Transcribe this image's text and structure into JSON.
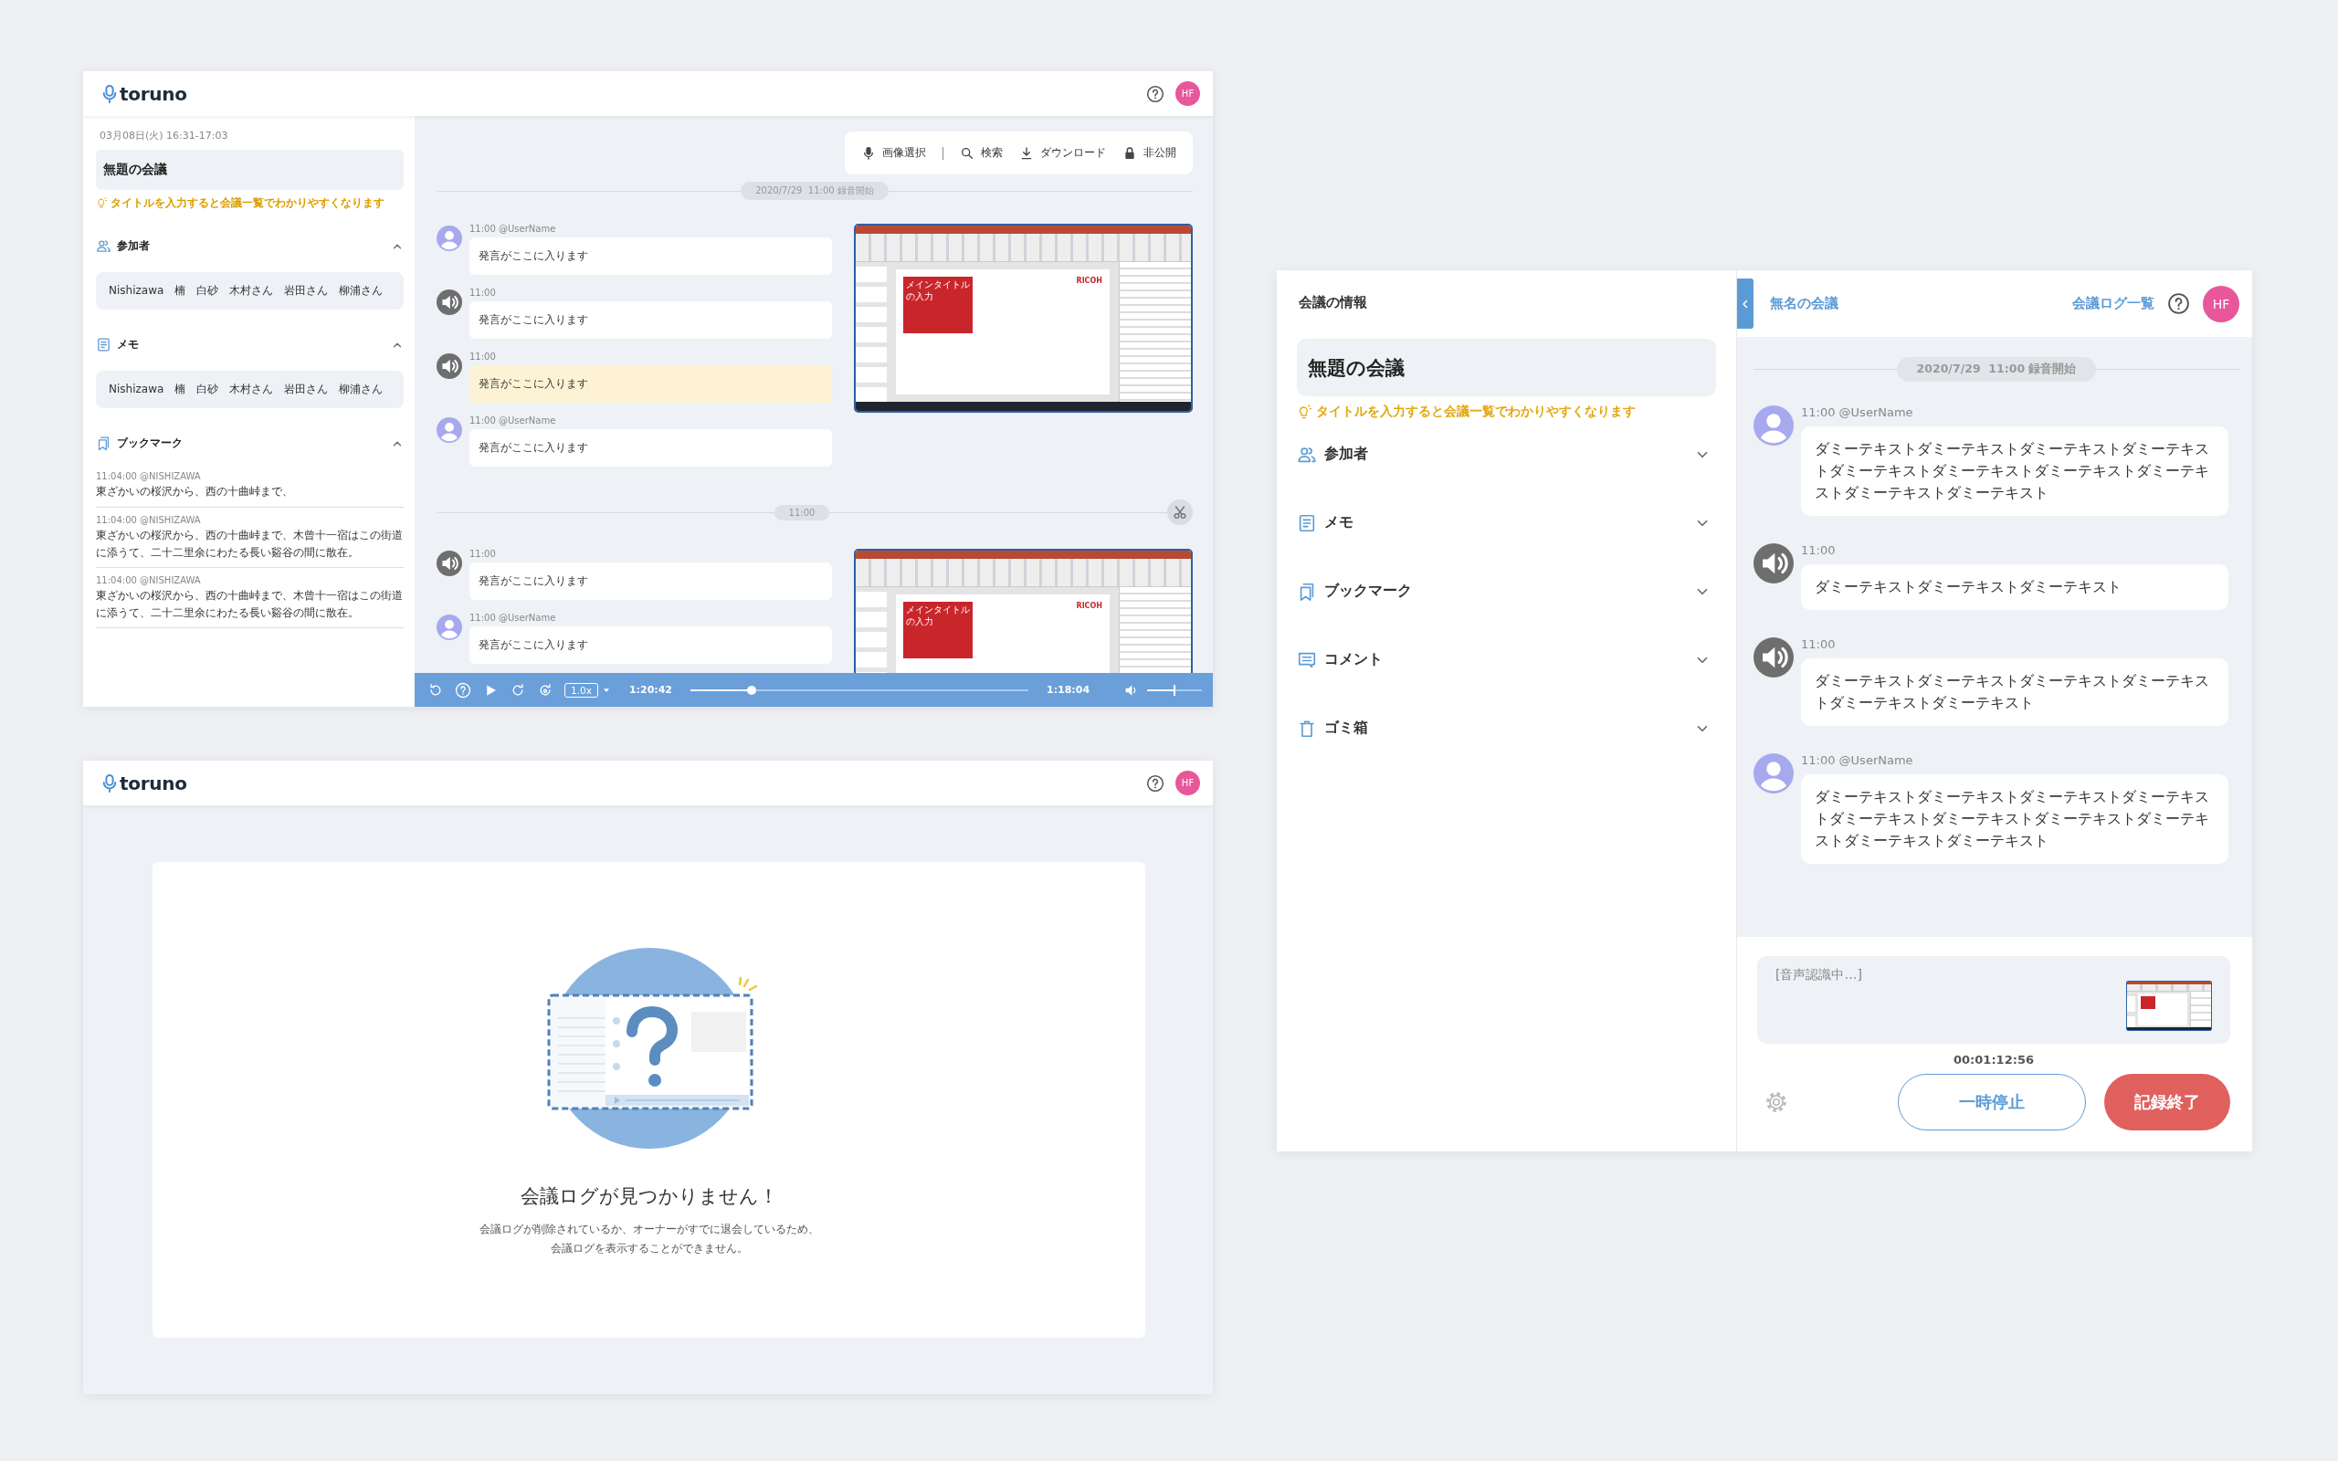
{
  "player_window": {
    "header": {
      "logo": "toruno",
      "avatar": "HF"
    },
    "sidebar": {
      "datetime": "03月08日(火) 16:31-17:03",
      "title": "無題の会議",
      "hint": "タイトルを入力すると会議一覧でわかりやすくなります",
      "sections": [
        {
          "kind": "participants",
          "label": "参加者",
          "expanded": true,
          "text": "Nishizawa　楠　白砂　木村さん　岩田さん　柳浦さん"
        },
        {
          "kind": "memo",
          "label": "メモ",
          "expanded": true,
          "text": "Nishizawa　楠　白砂　木村さん　岩田さん　柳浦さん"
        },
        {
          "kind": "bookmarks",
          "label": "ブックマーク",
          "expanded": true,
          "entries": [
            {
              "meta": "11:04:00 @NISHIZAWA",
              "text": "東ざかいの桜沢から、西の十曲峠まで、"
            },
            {
              "meta": "11:04:00 @NISHIZAWA",
              "text": "東ざかいの桜沢から、西の十曲峠まで、木曾十一宿はこの街道に添うて、二十二里余にわたる長い谿谷の間に散在。"
            },
            {
              "meta": "11:04:00 @NISHIZAWA",
              "text": "東ざかいの桜沢から、西の十曲峠まで、木曾十一宿はこの街道に添うて、二十二里余にわたる長い谿谷の間に散在。"
            }
          ]
        }
      ]
    },
    "toolbar": [
      {
        "kind": "mic",
        "label": "画像選択"
      },
      {
        "kind": "search",
        "label": "検索"
      },
      {
        "kind": "download",
        "label": "ダウンロード"
      },
      {
        "kind": "lock",
        "label": "非公開"
      }
    ],
    "groups": [
      {
        "divider": {
          "kind": "start",
          "text": "2020/7/29  11:00 録音開始"
        },
        "messages": [
          {
            "kind": "user",
            "meta": "11:00 @UserName",
            "text": "発言がここに入ります",
            "highlighted": false
          },
          {
            "kind": "audio",
            "meta": "11:00",
            "text": "発言がここに入ります",
            "highlighted": false
          },
          {
            "kind": "audio",
            "meta": "11:00",
            "text": "発言がここに入ります",
            "highlighted": true
          },
          {
            "kind": "user",
            "meta": "11:00 @UserName",
            "text": "発言がここに入ります",
            "highlighted": false
          }
        ],
        "screenshot": {
          "slide_title": "メインタイトルの入力",
          "logo": "RICOH"
        }
      },
      {
        "divider": {
          "kind": "split",
          "text": "11:00"
        },
        "messages": [
          {
            "kind": "audio",
            "meta": "11:00",
            "text": "発言がここに入ります",
            "highlighted": false
          },
          {
            "kind": "user",
            "meta": "11:00 @UserName",
            "text": "発言がここに入ります",
            "highlighted": false
          }
        ],
        "screenshot": {
          "slide_title": "メインタイトルの入力",
          "logo": "RICOH"
        }
      }
    ],
    "player": {
      "speed": "1.0x",
      "elapsed": "1:20:42",
      "level": 0.18,
      "remaining": "1:18:04",
      "volume": {
        "level": 0.5
      }
    }
  },
  "not_found_window": {
    "header": {
      "logo": "toruno",
      "avatar": "HF"
    },
    "title": "会議ログが見つかりません！",
    "message_lines": [
      "会議ログが削除されているか、オーナーがすでに退会しているため、",
      "会議ログを表示することができません。"
    ]
  },
  "recorder_window": {
    "sidebar": {
      "heading": "会議の情報",
      "title": "無題の会議",
      "hint": "タイトルを入力すると会議一覧でわかりやすくなります",
      "sections": [
        {
          "kind": "participants",
          "label": "参加者",
          "expanded": false
        },
        {
          "kind": "memo",
          "label": "メモ",
          "expanded": false
        },
        {
          "kind": "bookmarks",
          "label": "ブックマーク",
          "expanded": false
        },
        {
          "kind": "comments",
          "label": "コメント",
          "expanded": false
        },
        {
          "kind": "trash",
          "label": "ゴミ箱",
          "expanded": false
        }
      ]
    },
    "header": {
      "meeting_name": "無名の会議",
      "log_list_link": "会議ログ一覧",
      "avatar": "HF"
    },
    "divider": "2020/7/29  11:00 録音開始",
    "messages": [
      {
        "kind": "user",
        "meta": "11:00 @UserName",
        "text": "ダミーテキストダミーテキストダミーテキストダミーテキストダミーテキストダミーテキストダミーテキストダミーテキストダミーテキストダミーテキスト"
      },
      {
        "kind": "audio",
        "meta": "11:00",
        "text": "ダミーテキストダミーテキストダミーテキスト"
      },
      {
        "kind": "audio",
        "meta": "11:00",
        "text": "ダミーテキストダミーテキストダミーテキストダミーテキストダミーテキストダミーテキスト"
      },
      {
        "kind": "user",
        "meta": "11:00 @UserName",
        "text": "ダミーテキストダミーテキストダミーテキストダミーテキストダミーテキストダミーテキストダミーテキストダミーテキストダミーテキストダミーテキスト"
      }
    ],
    "recognition_status": "[音声認識中…]",
    "timer": "00:01:12:56",
    "pause_button": "一時停止",
    "stop_button": "記録終了"
  }
}
